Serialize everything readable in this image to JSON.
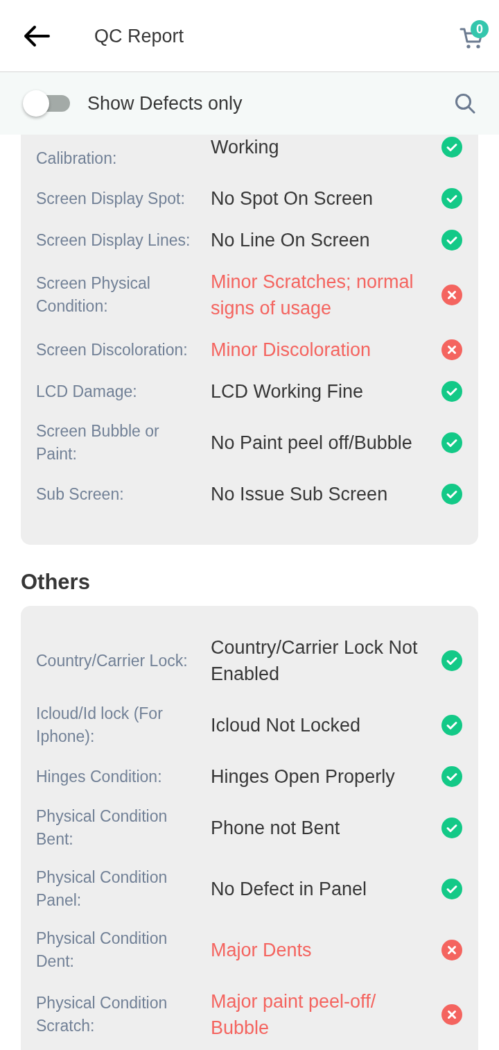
{
  "header": {
    "title": "QC Report",
    "cart_count": "0"
  },
  "filter": {
    "label": "Show Defects only",
    "on": false
  },
  "sections": [
    {
      "rows": [
        {
          "kind": "partly_hidden",
          "label": "Calibration:",
          "value": "Working",
          "passed": true
        },
        {
          "kind": "full",
          "label": "Screen Display Spot:",
          "value": "No Spot On Screen",
          "passed": true
        },
        {
          "kind": "full",
          "label": "Screen Display Lines:",
          "value": "No Line On Screen",
          "passed": true
        },
        {
          "kind": "full",
          "label": "Screen Physical Condition:",
          "value": "Minor Scratches; normal signs of usage",
          "passed": false
        },
        {
          "kind": "full",
          "label": "Screen Discoloration:",
          "value": "Minor Discoloration",
          "passed": false
        },
        {
          "kind": "full",
          "label": "LCD Damage:",
          "value": "LCD Working Fine",
          "passed": true
        },
        {
          "kind": "full",
          "label": "Screen Bubble or Paint:",
          "value": "No Paint peel off/Bubble",
          "passed": true
        },
        {
          "kind": "full",
          "label": "Sub Screen:",
          "value": "No Issue Sub Screen",
          "passed": true
        }
      ]
    },
    {
      "title": "Others",
      "rows": [
        {
          "kind": "full",
          "label": "Country/Carrier Lock:",
          "value": "Country/Carrier Lock Not Enabled",
          "passed": true
        },
        {
          "kind": "full",
          "label": "Icloud/Id lock (For Iphone):",
          "value": "Icloud Not Locked",
          "passed": true
        },
        {
          "kind": "full",
          "label": "Hinges Condition:",
          "value": "Hinges Open Properly",
          "passed": true
        },
        {
          "kind": "full",
          "label": "Physical Condition Bent:",
          "value": "Phone not Bent",
          "passed": true
        },
        {
          "kind": "full",
          "label": "Physical Condition Panel:",
          "value": "No Defect in Panel",
          "passed": true
        },
        {
          "kind": "full",
          "label": "Physical Condition Dent:",
          "value": "Major Dents",
          "passed": false
        },
        {
          "kind": "full",
          "label": "Physical Condition Scratch:",
          "value": "Major paint peel-off/Bubble",
          "passed": false
        }
      ]
    }
  ]
}
